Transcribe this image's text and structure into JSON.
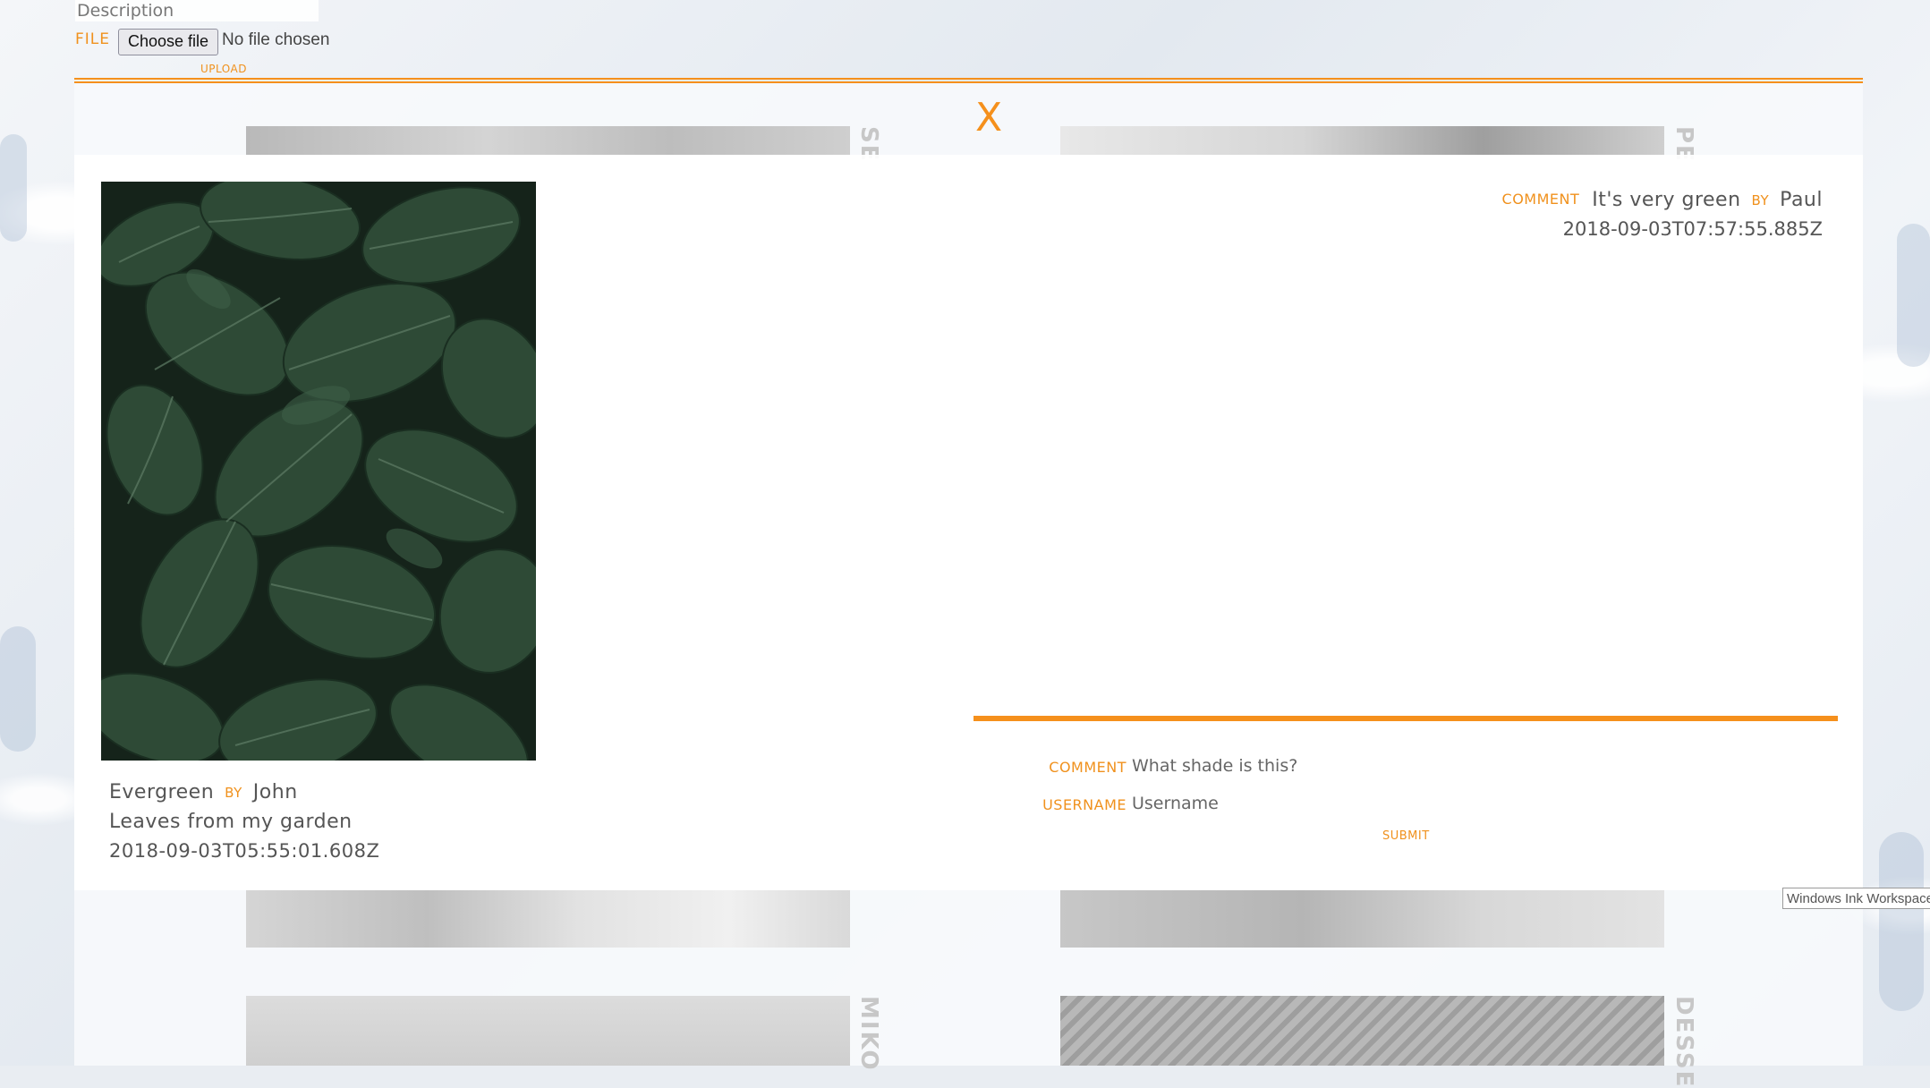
{
  "upload": {
    "description_placeholder": "Description",
    "file_label": "FILE",
    "choose_file_label": "Choose file",
    "no_file_text": "No file chosen",
    "upload_label": "UPLOAD"
  },
  "gallery": {
    "captions": [
      "SE",
      "PE",
      "MIKO",
      "DESSE"
    ]
  },
  "modal": {
    "close_label": "X",
    "image": {
      "title": "Evergreen",
      "by_label": "BY",
      "author": "John",
      "description": "Leaves from my garden",
      "date": "2018-09-03T05:55:01.608Z"
    },
    "comments": [
      {
        "tag": "COMMENT",
        "text": "It's very green",
        "by_label": "BY",
        "author": "Paul",
        "date": "2018-09-03T07:57:55.885Z"
      }
    ],
    "form": {
      "comment_label": "COMMENT",
      "comment_placeholder": "What shade is this?",
      "username_label": "USERNAME",
      "username_placeholder": "Username",
      "submit_label": "SUBMIT"
    }
  },
  "tooltip": {
    "text": "Windows Ink Workspace"
  },
  "colors": {
    "accent": "#f5901c",
    "text": "#555555"
  }
}
